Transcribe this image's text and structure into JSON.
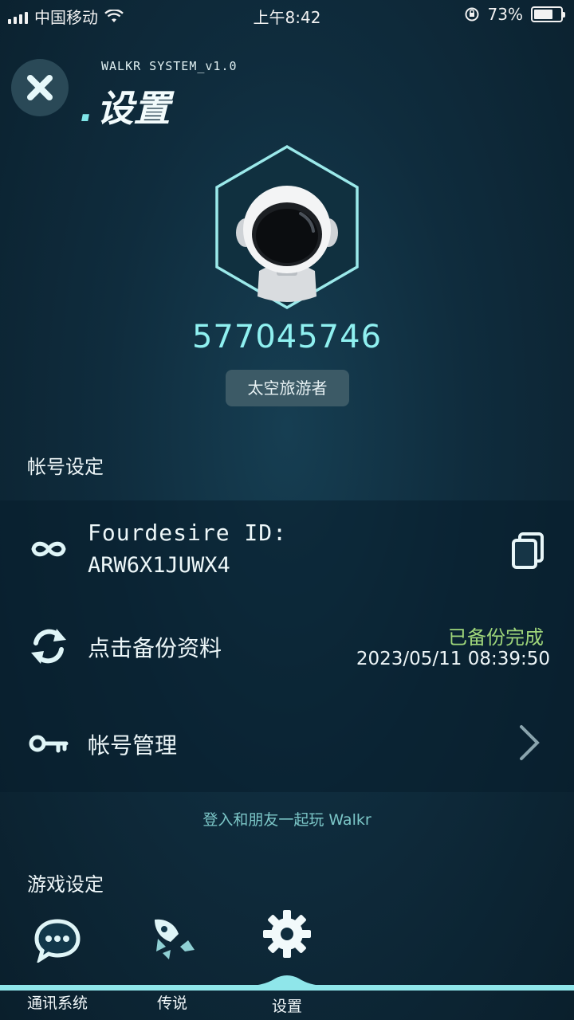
{
  "status_bar": {
    "carrier": "中国移动",
    "time": "上午8:42",
    "battery_percent": "73%",
    "battery_level": 0.73
  },
  "header": {
    "close_icon": "close-icon",
    "system_label": "WALKR SYSTEM_v1.0",
    "title": "设置"
  },
  "profile": {
    "avatar": "astronaut-avatar",
    "user_number": "577045746",
    "rank": "太空旅游者"
  },
  "account_section": {
    "title": "帐号设定",
    "fourdesire_label": "Fourdesire ID:",
    "fourdesire_id": "ARW6X1JUWX4",
    "backup_label": "点击备份资料",
    "backup_status": "已备份完成",
    "backup_time": "2023/05/11 08:39:50",
    "account_manage_label": "帐号管理",
    "login_hint": "登入和朋友一起玩 Walkr"
  },
  "game_section": {
    "title": "游戏设定"
  },
  "tabs": [
    {
      "label": "通讯系统",
      "icon": "chat-icon"
    },
    {
      "label": "传说",
      "icon": "rocket-icon"
    },
    {
      "label": "设置",
      "icon": "gear-icon",
      "active": true
    }
  ],
  "colors": {
    "accent": "#8ff0f0",
    "success": "#9fd67a",
    "background": "#0f2c3d"
  }
}
